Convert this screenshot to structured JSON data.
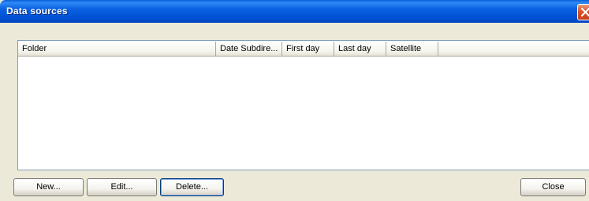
{
  "window": {
    "title": "Data sources"
  },
  "list": {
    "columns": [
      "Folder",
      "Date Subdire...",
      "First day",
      "Last day",
      "Satellite"
    ],
    "rows": []
  },
  "buttons": {
    "new": "New...",
    "edit": "Edit...",
    "delete": "Delete...",
    "close": "Close"
  },
  "icons": {
    "close": "close-x-icon"
  },
  "colors": {
    "titlebar": "#0A61E2",
    "close_button": "#D9542D",
    "dialog_bg": "#ECE9D8",
    "list_border": "#7F9DB9"
  }
}
